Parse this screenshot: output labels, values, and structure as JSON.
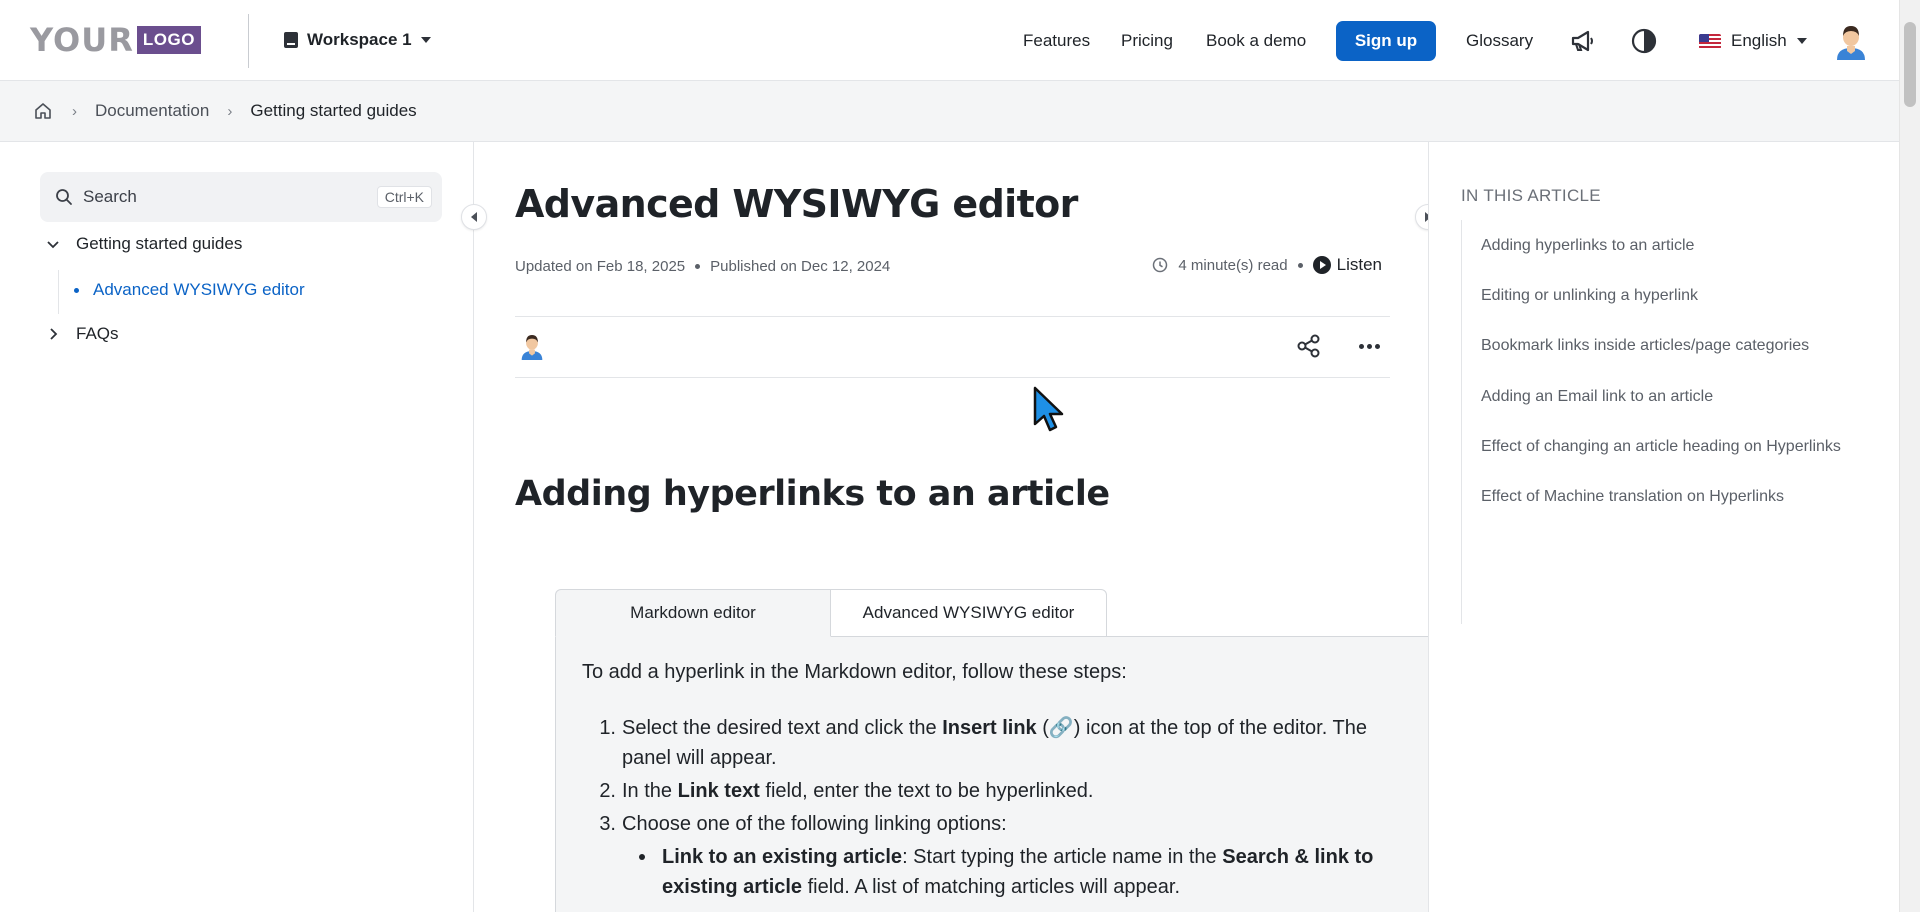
{
  "header": {
    "logo_main": "YOUR",
    "logo_box": "LOGO",
    "workspace": "Workspace 1",
    "nav": [
      "Features",
      "Pricing",
      "Book a demo"
    ],
    "signup": "Sign up",
    "glossary": "Glossary",
    "language": "English"
  },
  "breadcrumb": {
    "items": [
      "Documentation",
      "Getting started guides"
    ]
  },
  "sidebar": {
    "search_placeholder": "Search",
    "search_shortcut": "Ctrl+K",
    "tree": {
      "category": "Getting started guides",
      "active_article": "Advanced WYSIWYG editor",
      "faqs": "FAQs"
    }
  },
  "article": {
    "title": "Advanced WYSIWYG editor",
    "updated": "Updated on Feb 18, 2025",
    "published": "Published on Dec 12, 2024",
    "read_time": "4 minute(s) read",
    "listen": "Listen",
    "section_heading": "Adding hyperlinks to an article",
    "tabs": [
      "Markdown editor",
      "Advanced WYSIWYG editor"
    ],
    "intro": "To add a hyperlink in the Markdown editor, follow these steps:",
    "steps": {
      "s1_a": "Select the desired text and click the ",
      "s1_b": "Insert link",
      "s1_c": " (🔗) icon at the top of the editor. The  panel will appear.",
      "s2_a": "In the ",
      "s2_b": "Link text",
      "s2_c": " field, enter the text to be hyperlinked.",
      "s3": "Choose one of the following linking options:",
      "b1_a": "Link to an existing article",
      "b1_b": ": Start typing the article name in the ",
      "b1_c": "Search & link to existing article",
      "b1_d": " field. A list of matching articles will appear."
    }
  },
  "toc": {
    "title": "IN THIS ARTICLE",
    "items": [
      "Adding hyperlinks to an article",
      "Editing or unlinking a hyperlink",
      "Bookmark links inside articles/page categories",
      "Adding an Email link to an article",
      "Effect of changing an article heading on Hyperlinks",
      "Effect of Machine translation on Hyperlinks"
    ]
  },
  "colors": {
    "accent": "#0b63c6",
    "logo_box": "#6b4e8e"
  },
  "icons": [
    "book-icon",
    "megaphone-icon",
    "contrast-icon",
    "home-icon",
    "search-icon",
    "clock-icon",
    "play-icon",
    "share-icon",
    "more-icon",
    "link-icon"
  ]
}
